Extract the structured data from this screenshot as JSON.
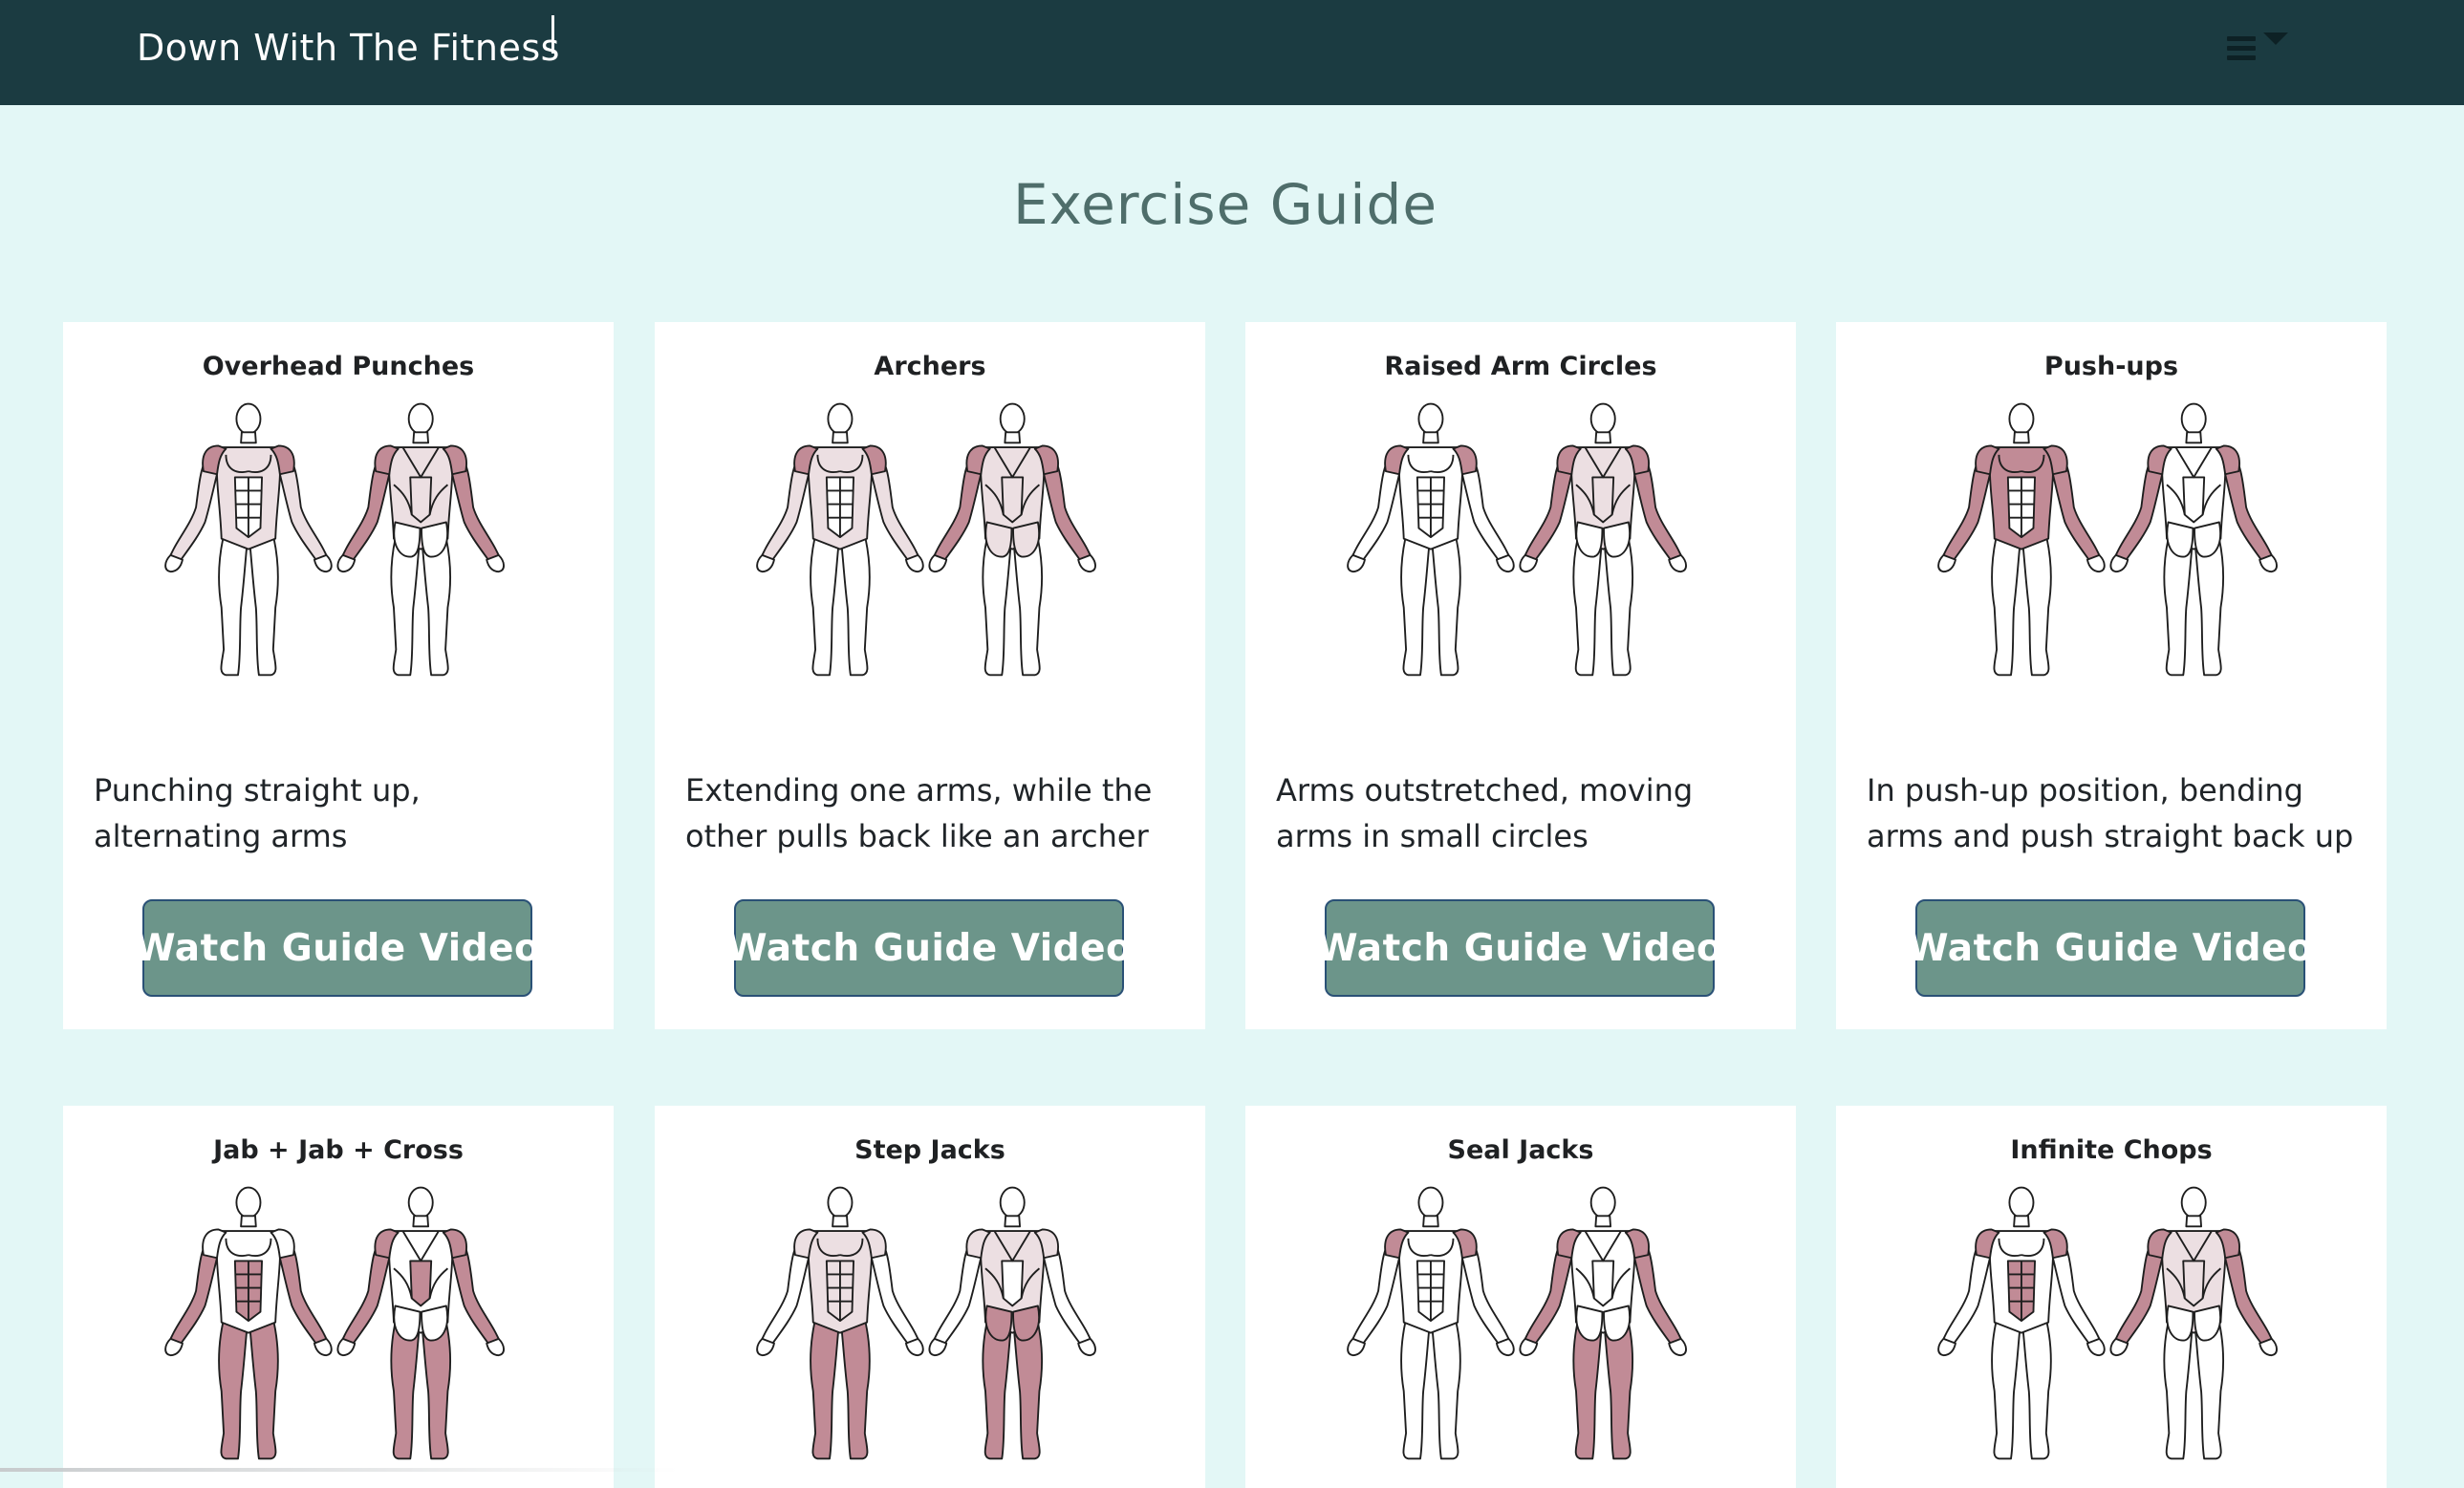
{
  "navbar": {
    "brand": "Down With The Fitness",
    "menu_icon": "hamburger-icon",
    "dropdown_icon": "chevron-down-icon"
  },
  "page": {
    "title": "Exercise Guide"
  },
  "colors": {
    "navbar_bg": "#1b3b41",
    "page_bg": "#e3f7f6",
    "button_bg": "#6c958a",
    "primary_muscle": "#c18b96",
    "secondary_muscle": "#ecdfe2"
  },
  "exercises": [
    {
      "title": "Overhead Punches",
      "description": "Punching straight up, alternating arms",
      "button_label": "Watch Guide Video",
      "front": {
        "shoulders": "p",
        "chest": "s",
        "arms": "s",
        "abs": "",
        "legs": ""
      },
      "back": {
        "traps": "p",
        "upper": "s",
        "arms": "p",
        "lower": "s",
        "glutes": "",
        "legs": ""
      }
    },
    {
      "title": "Archers",
      "description": "Extending one arms, while the other pulls back like an archer",
      "button_label": "Watch Guide Video",
      "front": {
        "shoulders": "p",
        "chest": "s",
        "arms": "s",
        "abs": "",
        "legs": ""
      },
      "back": {
        "traps": "p",
        "upper": "s",
        "arms": "p",
        "lower": "s",
        "glutes": "s",
        "legs": ""
      }
    },
    {
      "title": "Raised Arm Circles",
      "description": "Arms outstretched, moving arms in small circles",
      "button_label": "Watch Guide Video",
      "front": {
        "shoulders": "p",
        "chest": "",
        "arms": "",
        "abs": "",
        "legs": ""
      },
      "back": {
        "traps": "p",
        "upper": "s",
        "arms": "p",
        "lower": "s",
        "glutes": "",
        "legs": ""
      }
    },
    {
      "title": "Push-ups",
      "description": "In push-up position, bending arms and push straight back up",
      "button_label": "Watch Guide Video",
      "front": {
        "shoulders": "p",
        "chest": "p",
        "arms": "p",
        "abs": "",
        "legs": ""
      },
      "back": {
        "traps": "p",
        "upper": "",
        "arms": "p",
        "lower": "",
        "glutes": "",
        "legs": ""
      }
    },
    {
      "title": "Jab + Jab + Cross",
      "description": "",
      "button_label": "",
      "front": {
        "shoulders": "",
        "chest": "",
        "arms": "p",
        "abs": "p",
        "legs": "p"
      },
      "back": {
        "traps": "p",
        "upper": "",
        "arms": "p",
        "lower": "p",
        "glutes": "",
        "legs": "p"
      }
    },
    {
      "title": "Step Jacks",
      "description": "",
      "button_label": "",
      "front": {
        "shoulders": "s",
        "chest": "s",
        "arms": "",
        "abs": "s",
        "legs": "p"
      },
      "back": {
        "traps": "s",
        "upper": "s",
        "arms": "",
        "lower": "",
        "glutes": "p",
        "legs": "p"
      }
    },
    {
      "title": "Seal Jacks",
      "description": "",
      "button_label": "",
      "front": {
        "shoulders": "p",
        "chest": "",
        "arms": "",
        "abs": "",
        "legs": ""
      },
      "back": {
        "traps": "p",
        "upper": "",
        "arms": "p",
        "lower": "",
        "glutes": "",
        "legs": "p"
      }
    },
    {
      "title": "Infinite Chops",
      "description": "",
      "button_label": "",
      "front": {
        "shoulders": "p",
        "chest": "",
        "arms": "",
        "abs": "p",
        "legs": ""
      },
      "back": {
        "traps": "p",
        "upper": "s",
        "arms": "p",
        "lower": "s",
        "glutes": "",
        "legs": ""
      }
    }
  ]
}
